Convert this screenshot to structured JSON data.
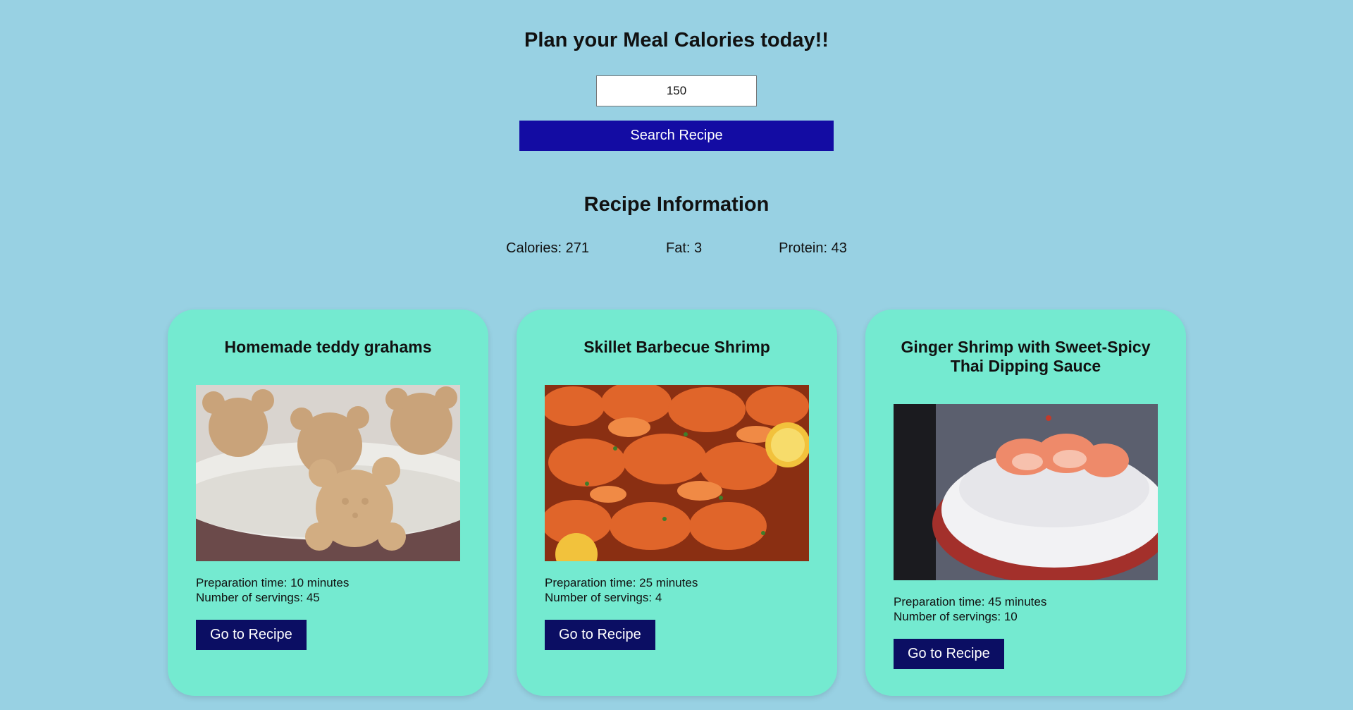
{
  "header": {
    "title": "Plan your Meal Calories today!!"
  },
  "search": {
    "value": "150",
    "button_label": "Search Recipe"
  },
  "info": {
    "title": "Recipe Information",
    "calories": "Calories: 271",
    "fat": "Fat: 3",
    "protein": "Protein: 43"
  },
  "recipes": [
    {
      "title": "Homemade teddy grahams",
      "image": "teddy-grahams-photo",
      "prep": "Preparation time: 10 minutes",
      "servings": "Number of servings: 45",
      "button_label": "Go to Recipe"
    },
    {
      "title": "Skillet Barbecue Shrimp",
      "image": "barbecue-shrimp-photo",
      "prep": "Preparation time: 25 minutes",
      "servings": "Number of servings: 4",
      "button_label": "Go to Recipe"
    },
    {
      "title": "Ginger Shrimp with Sweet-Spicy Thai Dipping Sauce",
      "image": "ginger-shrimp-photo",
      "prep": "Preparation time: 45 minutes",
      "servings": "Number of servings: 10",
      "button_label": "Go to Recipe"
    }
  ],
  "colors": {
    "page_background": "#98d1e3",
    "card_background": "#74ead0",
    "search_button": "#130ca3",
    "recipe_button": "#0b0e63"
  }
}
